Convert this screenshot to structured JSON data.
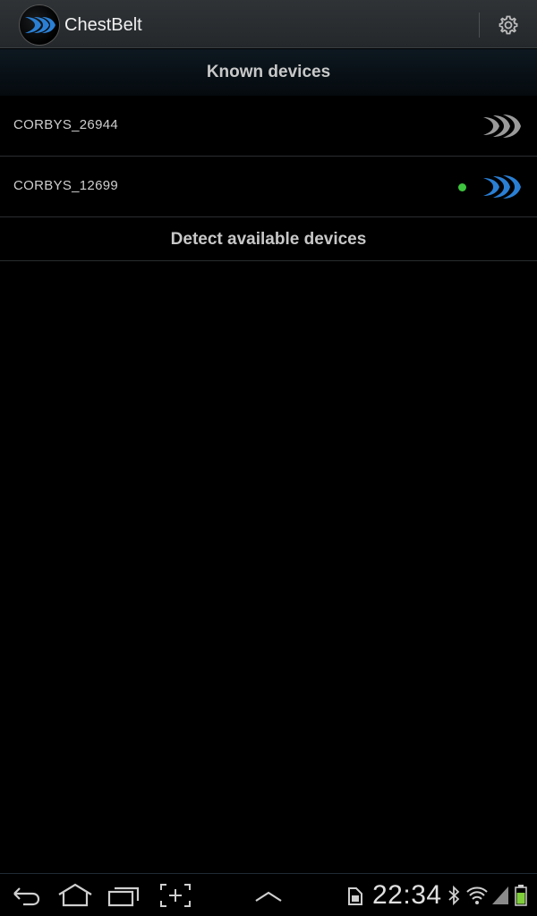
{
  "app": {
    "title": "ChestBelt",
    "logo_icon": "chestbelt-waves-icon",
    "settings_icon": "gear-icon"
  },
  "known_devices": {
    "header": "Known devices",
    "items": [
      {
        "name": "CORBYS_26944",
        "connected": false,
        "icon": "chestbelt-waves-gray-icon"
      },
      {
        "name": "CORBYS_12699",
        "connected": true,
        "icon": "chestbelt-waves-blue-icon",
        "status_color": "#3ec43e"
      }
    ]
  },
  "detect": {
    "label": "Detect available devices"
  },
  "system_bar": {
    "time": "22:34",
    "icons": [
      "back-icon",
      "home-icon",
      "recent-apps-icon",
      "screenshot-icon",
      "up-chevron-icon",
      "sd-card-icon",
      "bluetooth-icon",
      "wifi-icon",
      "signal-icon",
      "battery-icon"
    ]
  },
  "colors": {
    "accent_blue": "#2a7fd4",
    "gray_icon": "#9a9a9a",
    "connected": "#3ec43e"
  }
}
